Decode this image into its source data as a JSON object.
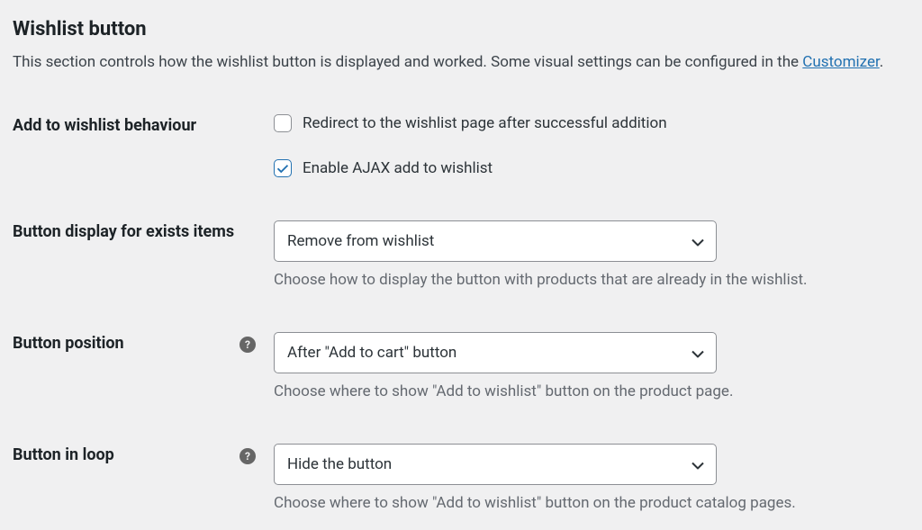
{
  "header": {
    "title": "Wishlist button",
    "description_prefix": "This section controls how the wishlist button is displayed and worked. Some visual settings can be configured in the ",
    "description_link": "Customizer",
    "description_suffix": "."
  },
  "fields": {
    "behaviour": {
      "label": "Add to wishlist behaviour",
      "options": [
        {
          "label": "Redirect to the wishlist page after successful addition",
          "checked": false
        },
        {
          "label": "Enable AJAX add to wishlist",
          "checked": true
        }
      ]
    },
    "exists_display": {
      "label": "Button display for exists items",
      "value": "Remove from wishlist",
      "description": "Choose how to display the button with products that are already in the wishlist."
    },
    "position": {
      "label": "Button position",
      "value": "After \"Add to cart\" button",
      "description": "Choose where to show \"Add to wishlist\" button on the product page."
    },
    "loop": {
      "label": "Button in loop",
      "value": "Hide the button",
      "description": "Choose where to show \"Add to wishlist\" button on the product catalog pages."
    }
  }
}
